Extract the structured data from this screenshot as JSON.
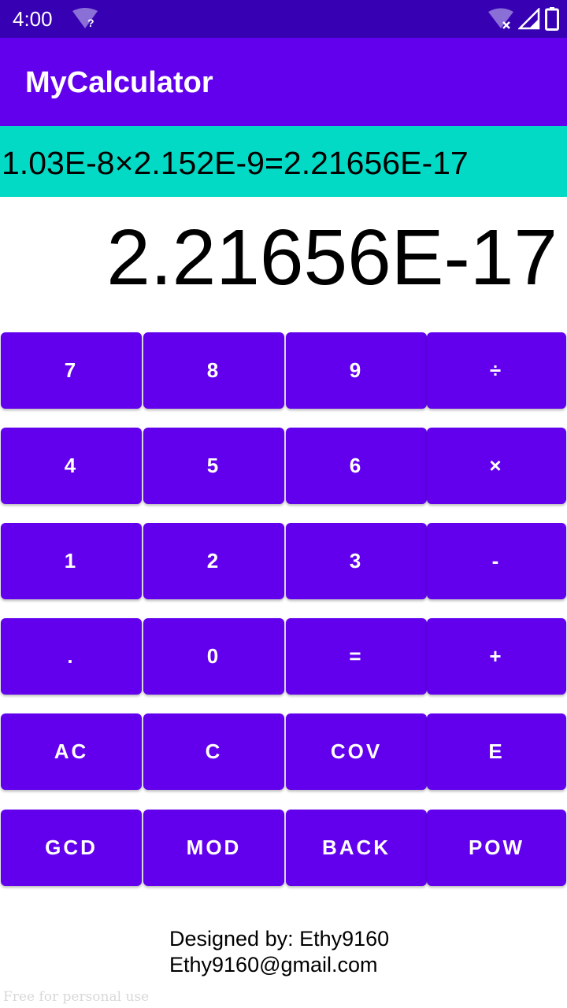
{
  "status_bar": {
    "time": "4:00",
    "wifi_unknown_glyph": "?",
    "icons": [
      "wifi-question-icon",
      "wifi-off-icon",
      "signal-icon",
      "battery-icon"
    ]
  },
  "app_bar": {
    "title": "MyCalculator"
  },
  "display": {
    "expression": "1.03E-8×2.152E-9=2.21656E-17",
    "result": "2.21656E-17"
  },
  "keypad": {
    "rows": [
      [
        "7",
        "8",
        "9",
        "÷"
      ],
      [
        "4",
        "5",
        "6",
        "×"
      ],
      [
        "1",
        "2",
        "3",
        "-"
      ],
      [
        ".",
        "0",
        "=",
        "+"
      ],
      [
        "AC",
        "C",
        "COV",
        "E"
      ],
      [
        "GCD",
        "MOD",
        "BACK",
        "POW"
      ]
    ]
  },
  "footer": {
    "designer": "Designed by: Ethy9160",
    "email": "Ethy9160@gmail.com",
    "watermark": "Free for personal use"
  },
  "colors": {
    "status_bar": "#3700b3",
    "primary": "#6200ee",
    "accent": "#03dac5"
  }
}
